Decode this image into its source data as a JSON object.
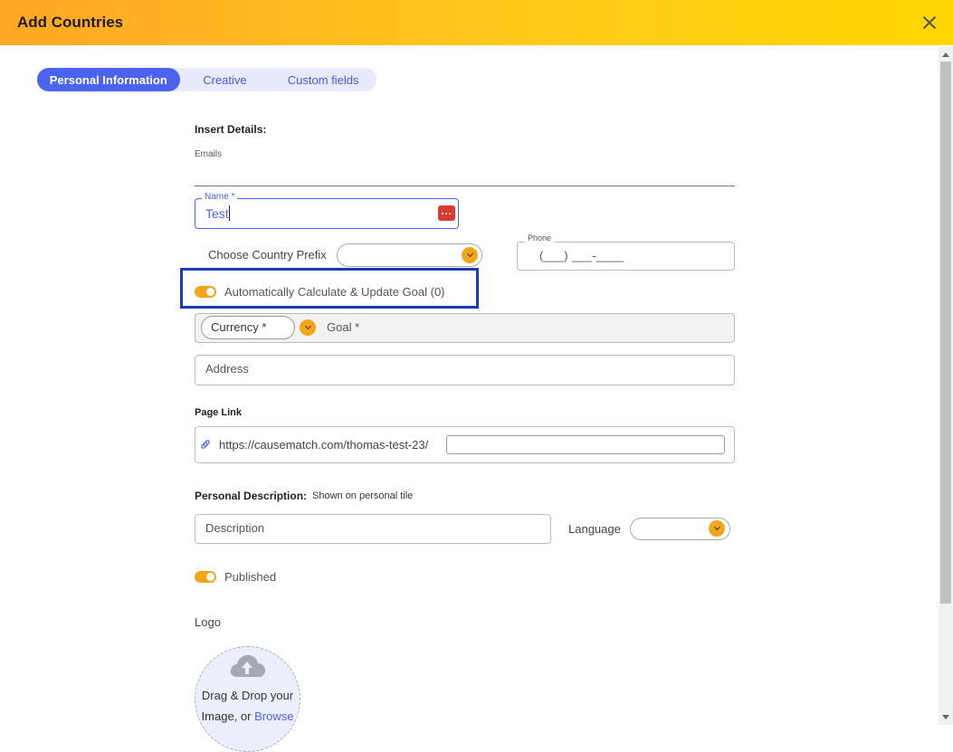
{
  "header": {
    "title": "Add Countries"
  },
  "tabs": [
    {
      "label": "Personal Information",
      "active": true
    },
    {
      "label": "Creative",
      "active": false
    },
    {
      "label": "Custom fields",
      "active": false
    }
  ],
  "form": {
    "insert_details_heading": "Insert Details:",
    "emails_label": "Emails",
    "name": {
      "label": "Name *",
      "value": "Test"
    },
    "country_prefix": {
      "label": "Choose Country Prefix",
      "value": ""
    },
    "phone": {
      "label": "Phone",
      "mask": "(___) ___-____"
    },
    "auto_goal": {
      "label": "Automatically Calculate & Update Goal (0)",
      "on": true
    },
    "currency": {
      "label": "Currency *"
    },
    "goal": {
      "placeholder": "Goal *"
    },
    "address": {
      "placeholder": "Address"
    },
    "page_link": {
      "heading": "Page Link",
      "prefix": "https://causematch.com/thomas-test-23/",
      "slug": ""
    },
    "personal_description": {
      "heading": "Personal Description:",
      "hint": "Shown on personal tile",
      "placeholder": "Description"
    },
    "language": {
      "label": "Language",
      "value": ""
    },
    "published": {
      "label": "Published",
      "on": true
    },
    "logo": {
      "label": "Logo",
      "drop_text": "Drag & Drop your Image, or",
      "browse": "Browse"
    }
  },
  "colors": {
    "accent": "#4b63f1",
    "toggle": "#f4a51c",
    "highlight": "#1a3bbd",
    "header_start": "#ffa726",
    "header_end": "#ffd600"
  },
  "icons": [
    "close-icon",
    "more-dots-icon",
    "chevron-down-icon",
    "link-icon",
    "cloud-upload-icon"
  ]
}
